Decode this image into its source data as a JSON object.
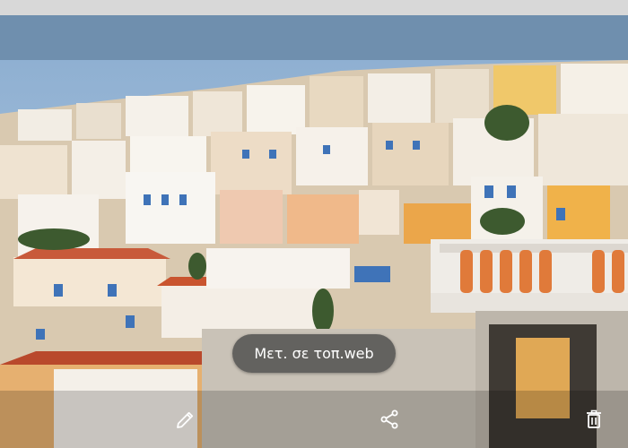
{
  "preview": {
    "search_pill_label": "Μετ. σε τοπ.web"
  },
  "actions": {
    "edit_icon": "pencil-icon",
    "share_icon": "share-icon",
    "delete_icon": "trash-icon"
  },
  "colors": {
    "status_strip": "#d8d8d8",
    "top_bar": "#6f8fae",
    "sky": "#9ab8d6",
    "pill_bg": "#464646",
    "icon": "#ffffff"
  }
}
